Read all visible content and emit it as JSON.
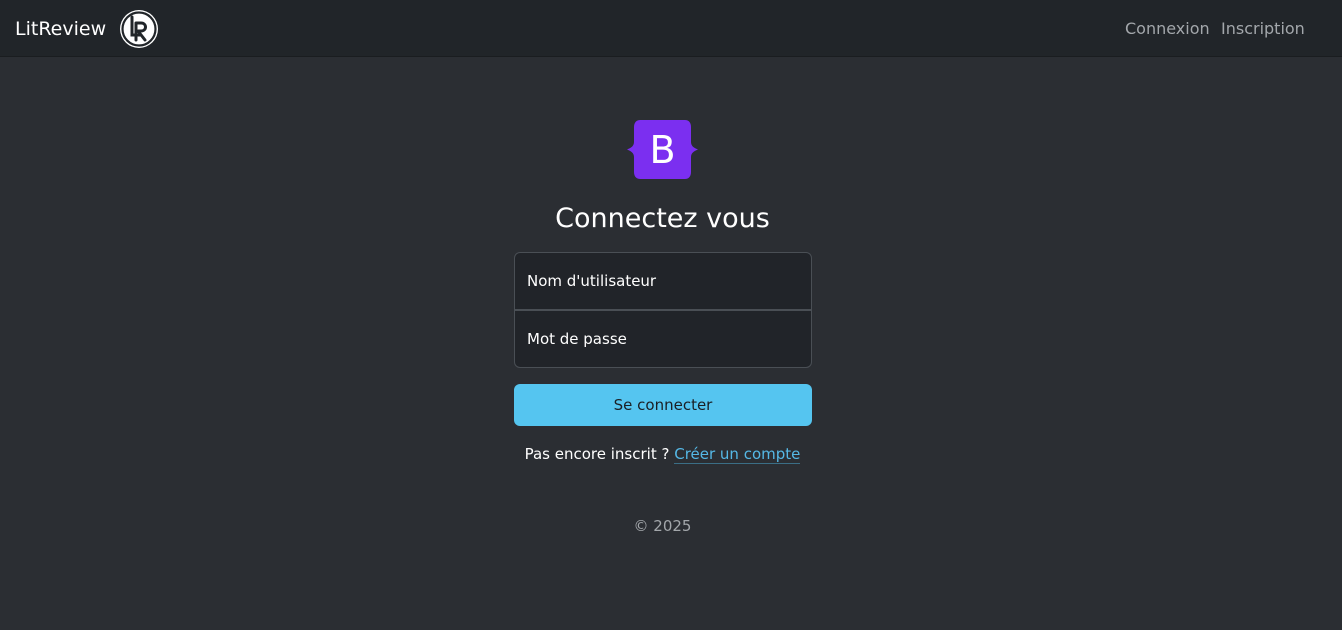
{
  "navbar": {
    "brand": "LitReview",
    "logo_icon": "litreview-logo-icon",
    "links": [
      {
        "label": "Connexion"
      },
      {
        "label": "Inscription"
      }
    ]
  },
  "main": {
    "logo_letter": "B",
    "logo_icon": "bootstrap-logo-icon",
    "logo_color": "#7b2ff0",
    "title": "Connectez vous",
    "username_placeholder": "Nom d'utilisateur",
    "password_placeholder": "Mot de passe",
    "submit_label": "Se connecter",
    "submit_color": "#55c5f0",
    "signup_prompt": "Pas encore inscrit ?",
    "signup_link": "Créer un compte"
  },
  "footer": {
    "text": "© 2025"
  }
}
